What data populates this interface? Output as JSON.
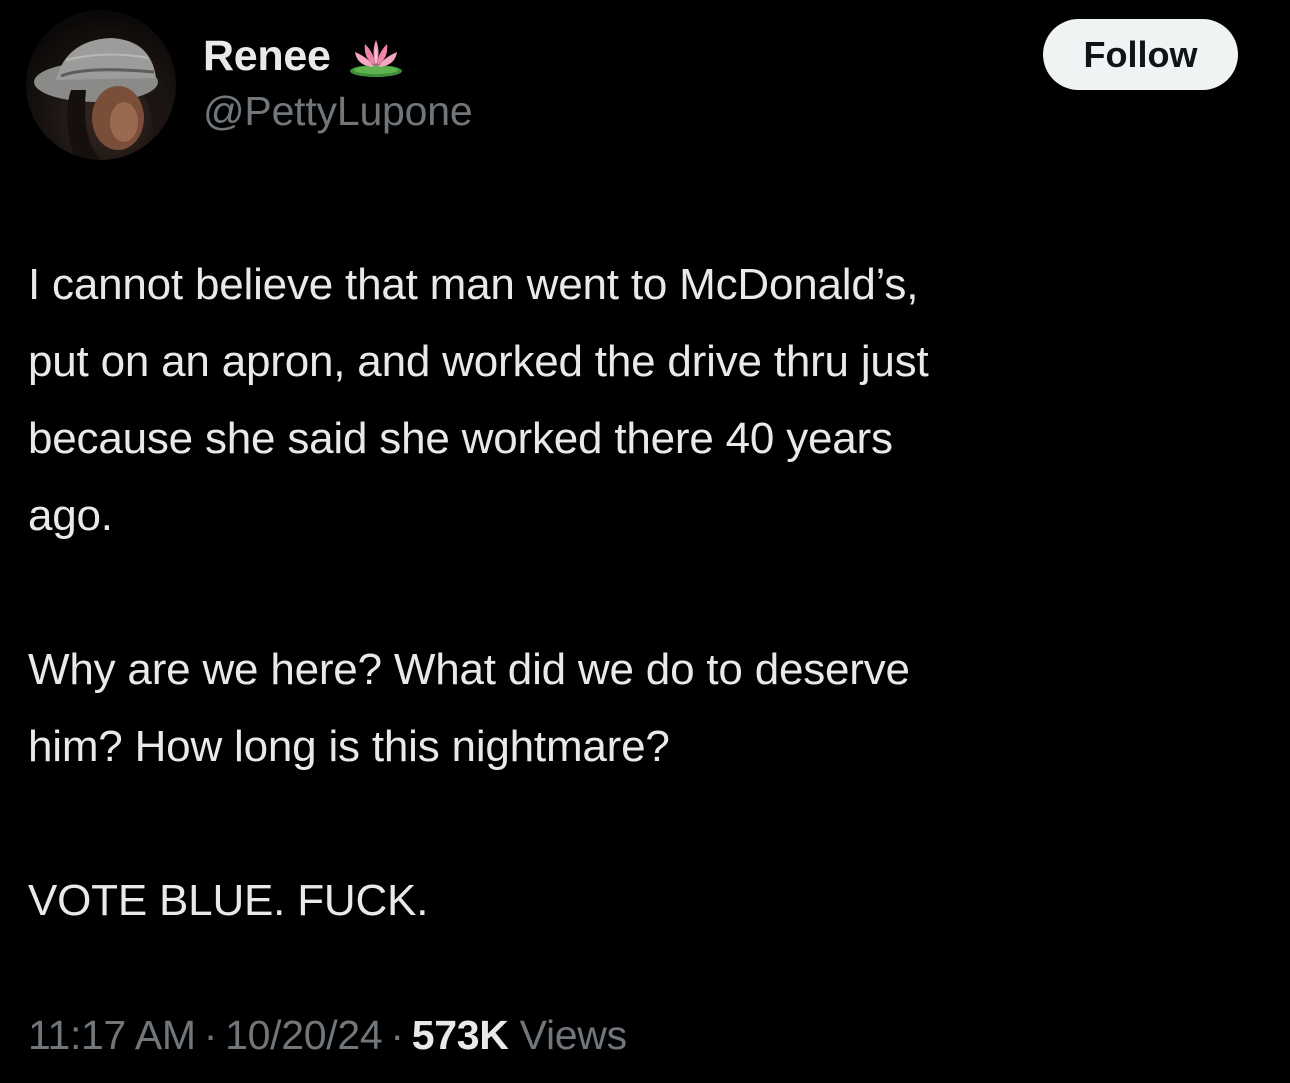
{
  "author": {
    "display_name": "Renee",
    "handle": "@PettyLupone",
    "badge_icon": "lotus-icon"
  },
  "follow_button_label": "Follow",
  "tweet": {
    "paragraphs": [
      {
        "lines": [
          "I cannot believe that man went to McDonald’s,",
          "put on an apron, and worked the drive thru just",
          "because she said she worked there 40 years",
          "ago."
        ]
      },
      {
        "lines": [
          "Why are we here? What did we do to deserve",
          "him? How long is this nightmare?"
        ]
      },
      {
        "lines": [
          "VOTE BLUE. FUCK."
        ]
      }
    ]
  },
  "meta": {
    "time": "11:17 AM",
    "date": "10/20/24",
    "separator": "·",
    "views_count": "573K",
    "views_label": "Views"
  },
  "colors": {
    "background": "#000000",
    "primary_text": "#e7e9ea",
    "secondary_text": "#71767b",
    "follow_bg": "#eff3f4",
    "follow_text": "#0f1419"
  }
}
